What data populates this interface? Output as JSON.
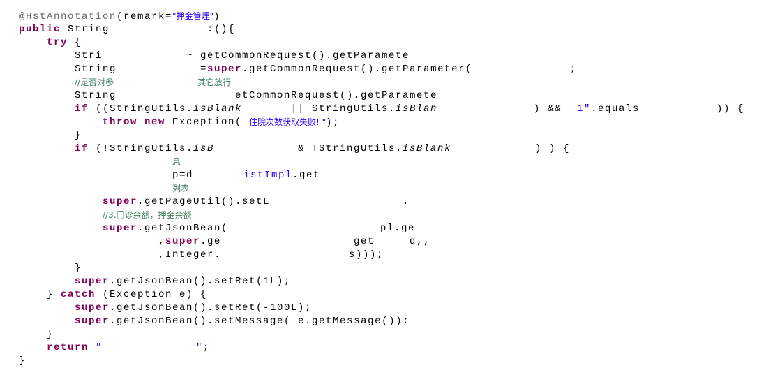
{
  "editor": {
    "colors": {
      "keyword": "#7f0055",
      "string": "#2a00ff",
      "comment": "#3f7f5f",
      "annotation": "#646464"
    },
    "lines": [
      [
        [
          {
            "t": "@HstAnnotation",
            "s": "ann"
          },
          {
            "t": "(remark="
          },
          {
            "t": "\"押金管理\"",
            "s": "str cjk"
          },
          {
            "t": ")"
          }
        ]
      ],
      [
        [
          {
            "t": "public",
            "s": "kw"
          },
          {
            "t": " String"
          }
        ],
        [
          {
            "t": ":(){"
          }
        ]
      ],
      [
        [
          {
            "t": "try",
            "s": "kw"
          },
          {
            "t": " {"
          }
        ]
      ],
      [
        [
          {
            "t": "Stri"
          }
        ],
        [
          {
            "t": "~"
          }
        ],
        [
          {
            "t": "getCommonRequest().getParamete"
          }
        ]
      ],
      [
        [
          {
            "t": "String"
          }
        ],
        [
          {
            "t": "="
          },
          {
            "t": "super",
            "s": "kw"
          },
          {
            "t": ".getCommonRequest().getParameter("
          }
        ],
        [
          {
            "t": ";"
          }
        ]
      ],
      [
        [
          {
            "t": "//是否对参",
            "s": "cmt cjk"
          }
        ],
        [
          {
            "t": "其它放行",
            "s": "cmt cjk"
          }
        ]
      ],
      [
        [
          {
            "t": "String"
          }
        ],
        [
          {
            "t": "etCommonRequest().getParamete"
          }
        ]
      ],
      [
        [
          {
            "t": "if",
            "s": "kw"
          },
          {
            "t": " ((StringUtils."
          },
          {
            "t": "isBlank",
            "s": "it"
          }
        ],
        [
          {
            "t": "|| StringUtils."
          },
          {
            "t": "isBlan",
            "s": "it"
          }
        ],
        [
          {
            "t": ") &&"
          }
        ],
        [
          {
            "t": "1\"",
            "s": "str"
          },
          {
            "t": ".equals"
          }
        ],
        [
          {
            "t": ")) {"
          }
        ]
      ],
      [
        [
          {
            "t": "throw",
            "s": "kw"
          },
          {
            "t": " "
          },
          {
            "t": "new",
            "s": "kw"
          },
          {
            "t": " Exception("
          }
        ],
        [
          {
            "t": "住院次数获取失败! \"",
            "s": "str cjk"
          },
          {
            "t": ");"
          }
        ]
      ],
      [
        [
          {
            "t": "}"
          }
        ]
      ],
      [
        [
          {
            "t": "if",
            "s": "kw"
          },
          {
            "t": " (!StringUtils."
          },
          {
            "t": "isB",
            "s": "it"
          }
        ],
        [
          {
            "t": "& !StringUtils."
          },
          {
            "t": "isBlank",
            "s": "it"
          }
        ],
        [
          {
            "t": ") ) {"
          }
        ]
      ],
      [
        [
          {
            "t": "息",
            "s": "cmt cjk"
          }
        ]
      ],
      [
        [
          {
            "t": "p=d"
          }
        ],
        [
          {
            "t": "istImpl",
            "s": "str"
          },
          {
            "t": ".get"
          }
        ]
      ],
      [
        [
          {
            "t": "列表",
            "s": "cmt cjk"
          }
        ]
      ],
      [
        [
          {
            "t": "super",
            "s": "kw"
          },
          {
            "t": ".getPageUtil().setL"
          }
        ],
        [
          {
            "t": "."
          }
        ]
      ],
      [
        [
          {
            "t": "//3.门诊余额，押金余额",
            "s": "cmt cjk"
          }
        ]
      ],
      [
        [
          {
            "t": "super",
            "s": "kw"
          },
          {
            "t": ".getJsonBean("
          }
        ],
        [
          {
            "t": "pl.ge"
          }
        ]
      ],
      [
        [
          {
            "t": ","
          },
          {
            "t": "super",
            "s": "kw"
          },
          {
            "t": ".ge"
          }
        ],
        [
          {
            "t": "get"
          }
        ],
        [
          {
            "t": "d,,"
          }
        ]
      ],
      [
        [
          {
            "t": ",Integer."
          }
        ],
        [
          {
            "t": "s)));"
          }
        ]
      ],
      [
        [
          {
            "t": "}"
          }
        ]
      ],
      [
        [
          {
            "t": "super",
            "s": "kw"
          },
          {
            "t": ".getJsonBean().setRet(1L);"
          }
        ]
      ],
      [
        [
          {
            "t": "} "
          },
          {
            "t": "catch",
            "s": "kw"
          },
          {
            "t": " (Exception e) {"
          }
        ]
      ],
      [
        [
          {
            "t": "super",
            "s": "kw"
          },
          {
            "t": ".getJsonBean().setRet(-100L);"
          }
        ]
      ],
      [
        [
          {
            "t": "super",
            "s": "kw"
          },
          {
            "t": ".getJsonBean().setMessage( e.getMessage());"
          }
        ]
      ],
      [
        [
          {
            "t": "}"
          }
        ]
      ],
      [
        [
          {
            "t": "return",
            "s": "kw"
          },
          {
            "t": " "
          },
          {
            "t": "\"",
            "s": "str"
          }
        ],
        [
          {
            "t": "\"",
            "s": "str"
          },
          {
            "t": ";"
          }
        ]
      ],
      [
        [
          {
            "t": "}"
          }
        ]
      ]
    ]
  }
}
